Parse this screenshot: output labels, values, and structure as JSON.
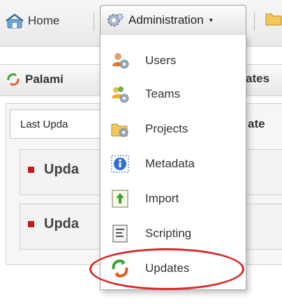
{
  "nav": {
    "home_label": "Home",
    "admin_label": "Administration",
    "admin_caret": "▾"
  },
  "background": {
    "panel_title": "Palami",
    "panel_title_suffix": "ates",
    "tab_left_label": "Last Upda",
    "tab_right_label": "ate",
    "rows": [
      {
        "label": "Upda"
      },
      {
        "label": "Upda"
      }
    ]
  },
  "menu": {
    "items": [
      {
        "label": "Users",
        "icon": "users-icon"
      },
      {
        "label": "Teams",
        "icon": "teams-icon"
      },
      {
        "label": "Projects",
        "icon": "projects-icon"
      },
      {
        "label": "Metadata",
        "icon": "metadata-icon"
      },
      {
        "label": "Import",
        "icon": "import-icon"
      },
      {
        "label": "Scripting",
        "icon": "scripting-icon"
      },
      {
        "label": "Updates",
        "icon": "updates-icon"
      }
    ]
  },
  "colors": {
    "highlight": "#d8262a",
    "bullet": "#c21b1b"
  }
}
